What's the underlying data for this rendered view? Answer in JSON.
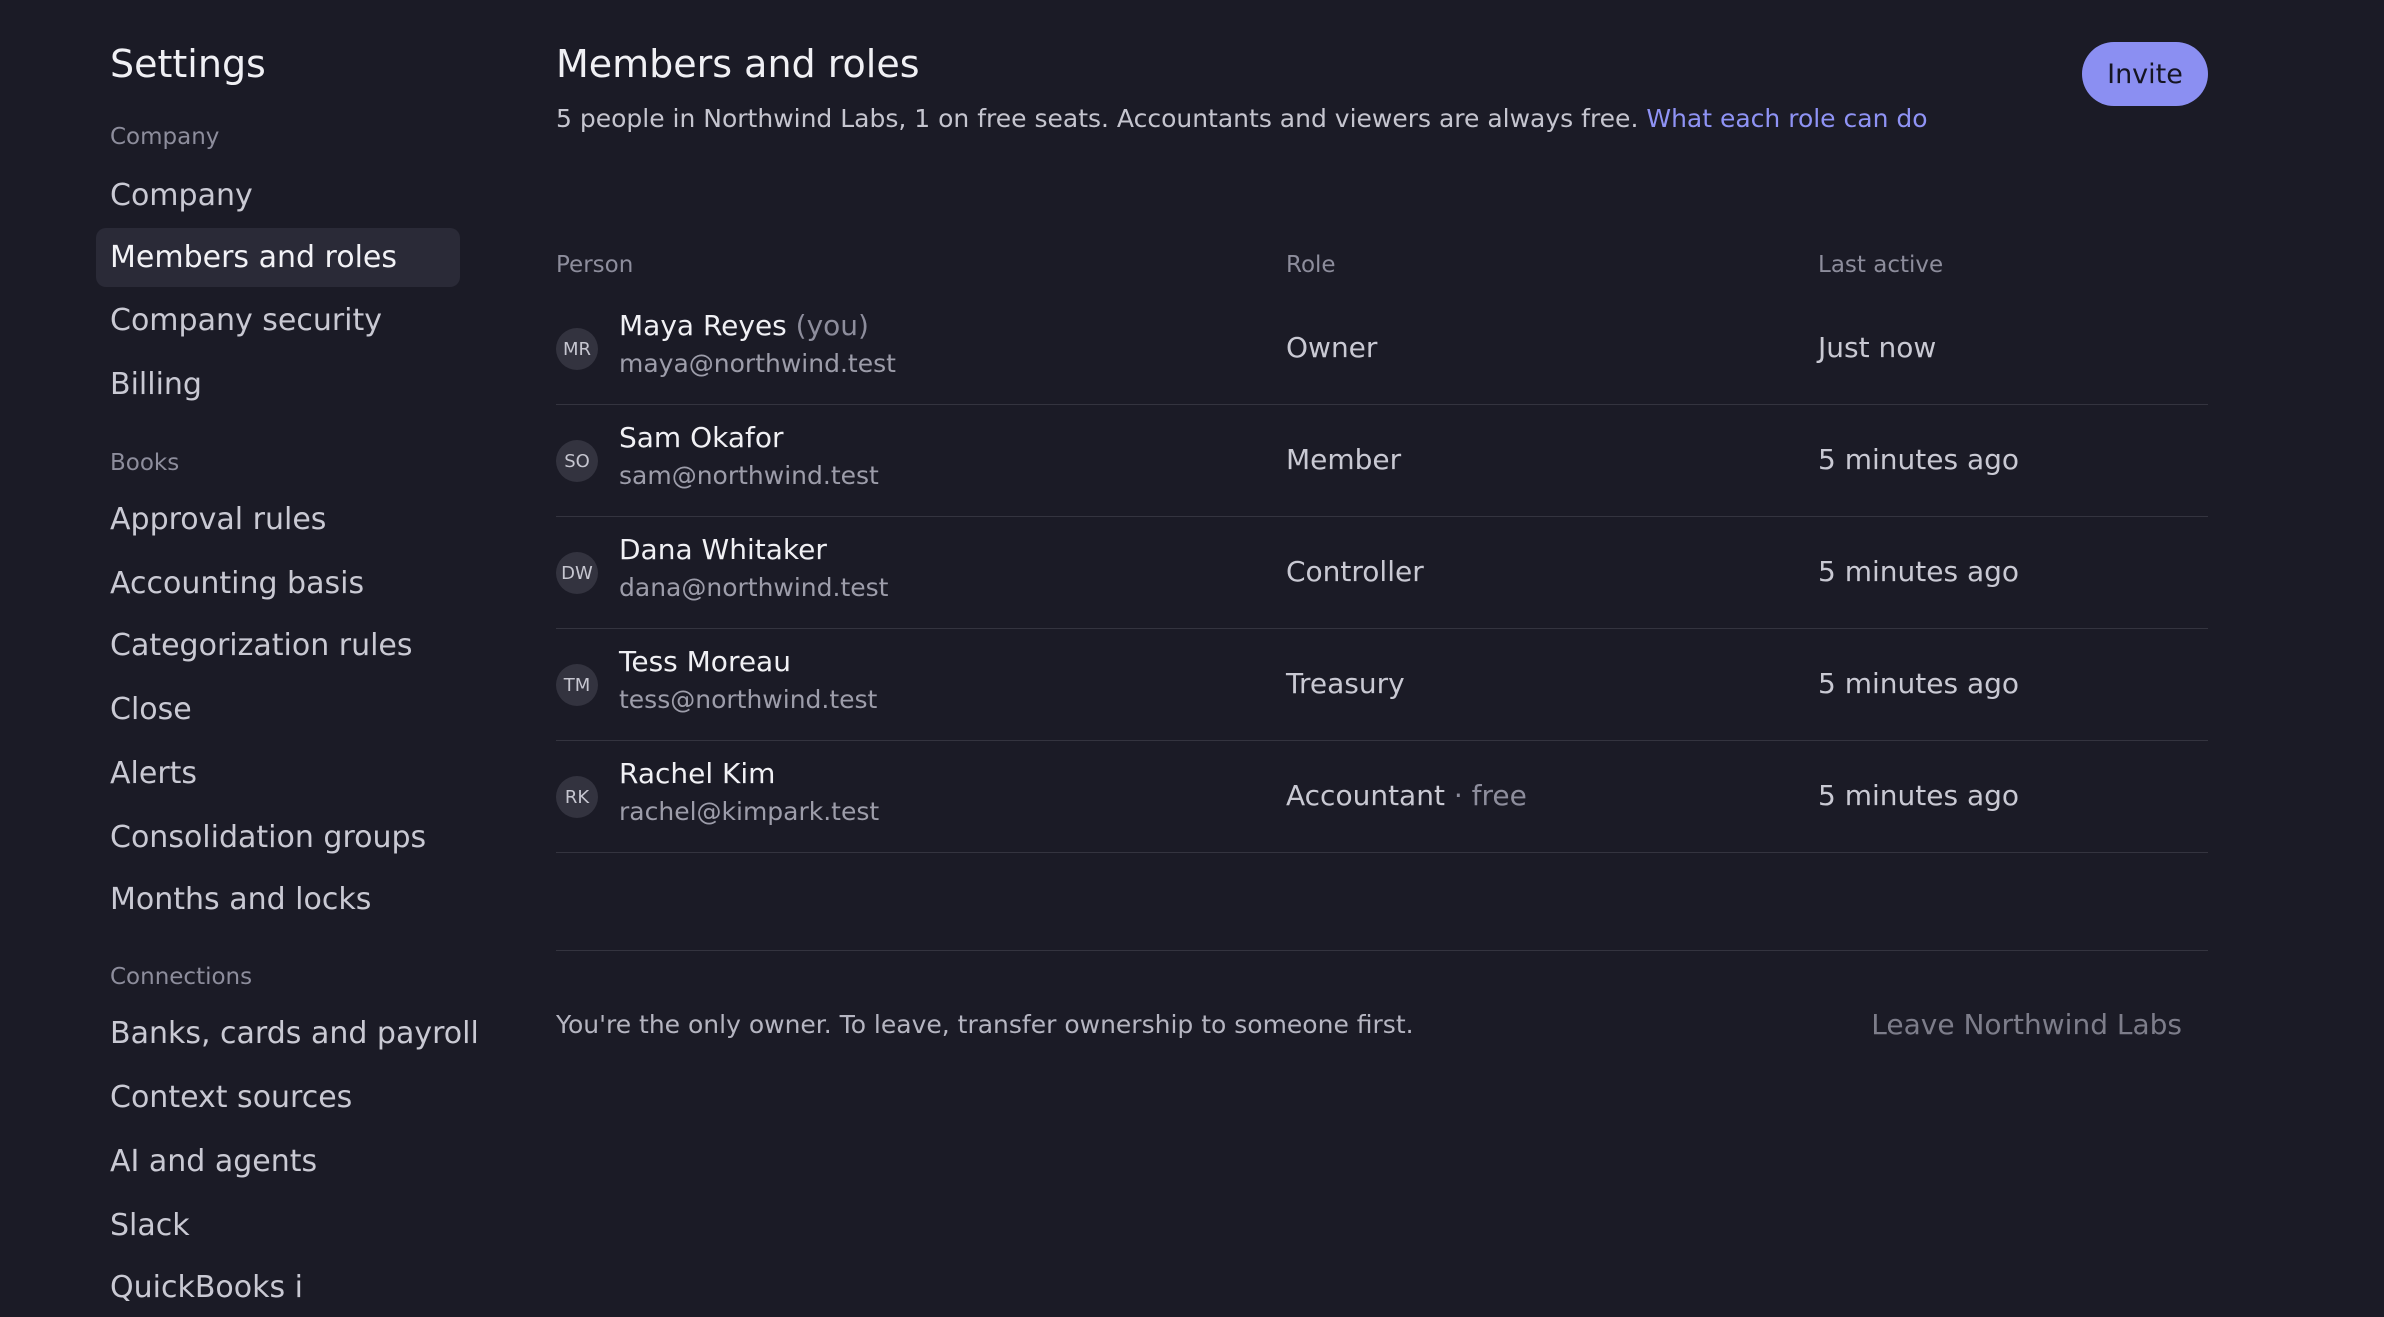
{
  "sidebar": {
    "title": "Settings",
    "groups": [
      {
        "label": "Company",
        "items": [
          "Company",
          "Members and roles",
          "Company security",
          "Billing"
        ]
      },
      {
        "label": "Books",
        "items": [
          "Approval rules",
          "Accounting basis",
          "Categorization rules",
          "Close",
          "Alerts",
          "Consolidation groups",
          "Months and locks"
        ]
      },
      {
        "label": "Connections",
        "items": [
          "Banks, cards and payroll",
          "Context sources",
          "AI and agents",
          "Slack",
          "QuickBooks i"
        ]
      }
    ],
    "active_item": "Members and roles"
  },
  "main": {
    "title": "Members and roles",
    "subtitle": "5 people in Northwind Labs, 1 on free seats. Accountants and viewers are always free.",
    "subtitle_link": "What each role can do",
    "invite_label": "Invite",
    "columns": [
      "Person",
      "Role",
      "Last active"
    ],
    "members": [
      {
        "initials": "MR",
        "name": "Maya Reyes",
        "tag": "(you)",
        "email": "maya@northwind.test",
        "role": "Owner",
        "role_note": "",
        "last_active": "Just now"
      },
      {
        "initials": "SO",
        "name": "Sam Okafor",
        "tag": "",
        "email": "sam@northwind.test",
        "role": "Member",
        "role_note": "",
        "last_active": "5 minutes ago"
      },
      {
        "initials": "DW",
        "name": "Dana Whitaker",
        "tag": "",
        "email": "dana@northwind.test",
        "role": "Controller",
        "role_note": "",
        "last_active": "5 minutes ago"
      },
      {
        "initials": "TM",
        "name": "Tess Moreau",
        "tag": "",
        "email": "tess@northwind.test",
        "role": "Treasury",
        "role_note": "",
        "last_active": "5 minutes ago"
      },
      {
        "initials": "RK",
        "name": "Rachel Kim",
        "tag": "",
        "email": "rachel@kimpark.test",
        "role": "Accountant",
        "role_note": "· free",
        "last_active": "5 minutes ago"
      }
    ],
    "footer_note": "You're the only owner. To leave, transfer ownership to someone first.",
    "leave_label": "Leave Northwind Labs"
  },
  "colors": {
    "background": "#1b1b26",
    "accent": "#8b8ff2",
    "link": "#8f93f5",
    "active_nav": "#2a2a37"
  }
}
